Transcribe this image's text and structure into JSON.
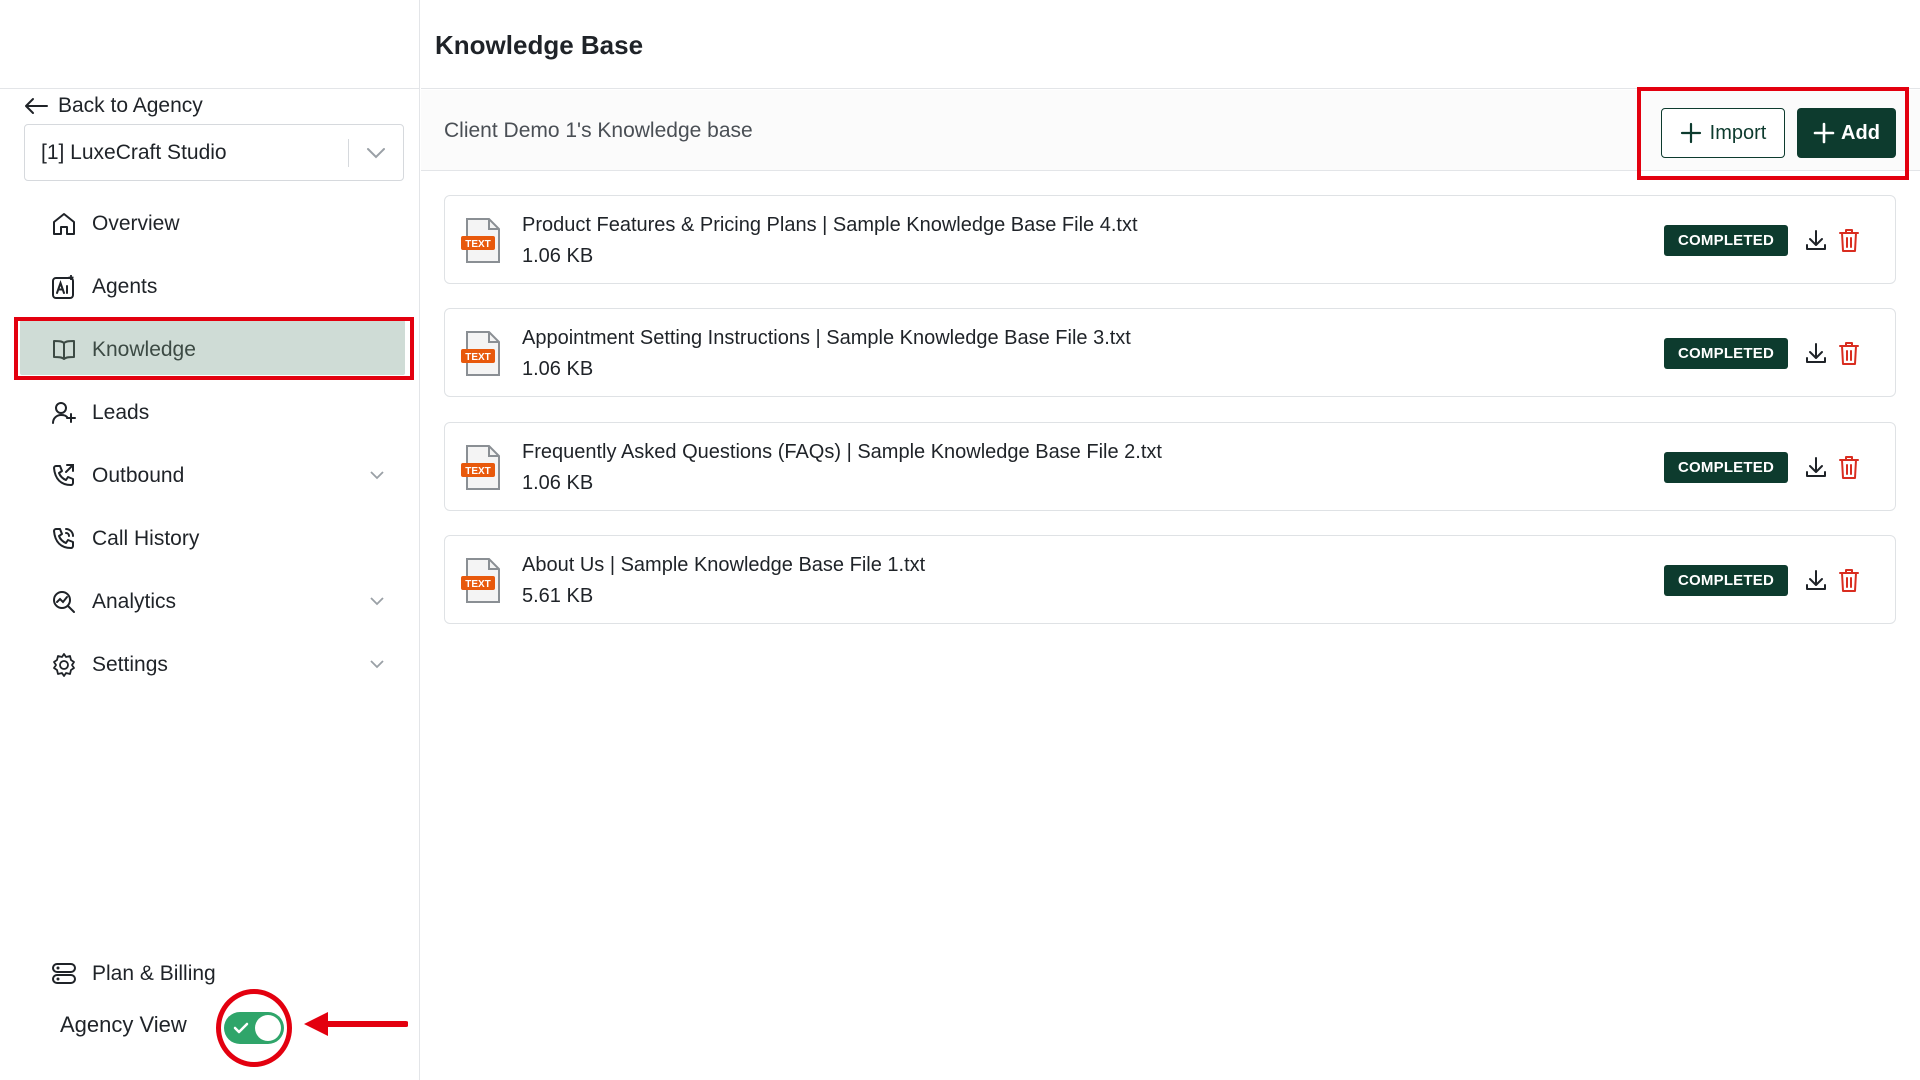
{
  "sidebar": {
    "back_label": "Back to Agency",
    "client_select": {
      "value": "[1] LuxeCraft Studio"
    },
    "items": [
      {
        "label": "Overview",
        "icon": "home-icon"
      },
      {
        "label": "Agents",
        "icon": "ai-agent-icon"
      },
      {
        "label": "Knowledge",
        "icon": "book-icon",
        "active": true
      },
      {
        "label": "Leads",
        "icon": "user-plus-icon"
      },
      {
        "label": "Outbound",
        "icon": "phone-outgoing-icon",
        "expandable": true
      },
      {
        "label": "Call History",
        "icon": "phone-history-icon"
      },
      {
        "label": "Analytics",
        "icon": "analytics-icon",
        "expandable": true
      },
      {
        "label": "Settings",
        "icon": "gear-icon",
        "expandable": true
      }
    ],
    "plan_billing_label": "Plan & Billing",
    "agency_view_label": "Agency View",
    "agency_view_enabled": true
  },
  "header": {
    "title": "Knowledge Base"
  },
  "kb": {
    "title": "Client Demo 1's Knowledge base",
    "import_label": "Import",
    "add_label": "Add"
  },
  "files": [
    {
      "name": "Product Features & Pricing Plans | Sample Knowledge Base File 4.txt",
      "size": "1.06 KB",
      "status": "COMPLETED",
      "type_label": "TEXT"
    },
    {
      "name": "Appointment Setting Instructions | Sample Knowledge Base File 3.txt",
      "size": "1.06 KB",
      "status": "COMPLETED",
      "type_label": "TEXT"
    },
    {
      "name": "Frequently Asked Questions (FAQs) | Sample Knowledge Base File 2.txt",
      "size": "1.06 KB",
      "status": "COMPLETED",
      "type_label": "TEXT"
    },
    {
      "name": "About Us | Sample Knowledge Base File 1.txt",
      "size": "5.61 KB",
      "status": "COMPLETED",
      "type_label": "TEXT"
    }
  ],
  "colors": {
    "accent": "#0d3b2e",
    "active_nav_bg": "#cfdcd6",
    "annotation_red": "#e3000f",
    "toggle_green": "#2fa56a",
    "file_icon_orange": "#e8590c",
    "delete_red": "#d92d20"
  }
}
